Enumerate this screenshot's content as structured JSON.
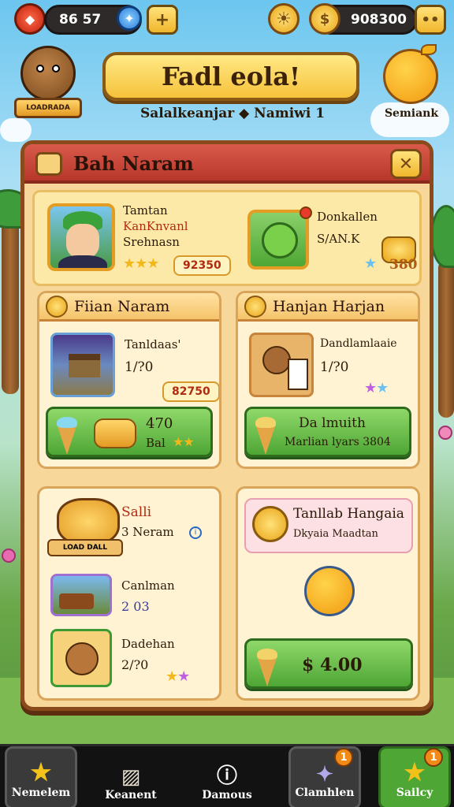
{
  "topbar": {
    "gems_value": "86 57",
    "plus_label": "+",
    "coins_value": "908300"
  },
  "header": {
    "title": "Fadl eola!",
    "subtitle": "Salalkeanjar ◆ Namiwi 1",
    "logo_text": "LOADRADA",
    "bonus_label": "Semiank"
  },
  "panel": {
    "title": "Bah Naram",
    "close_label": "✕"
  },
  "featured": {
    "left": {
      "line1": "Tamtan",
      "line2": "KanKnvanl",
      "line3": "Srehnasn",
      "price": "92350"
    },
    "right": {
      "name": "Donkallen",
      "value": "S/AN.K",
      "coin_value": "380"
    }
  },
  "section_left": {
    "title": "Fiian Naram",
    "item_name": "Tanldaas'",
    "item_count": "1/?0",
    "price": "82750",
    "btn_value": "470",
    "btn_label": "Bal"
  },
  "section_right": {
    "title": "Hanjan Harjan",
    "item_name": "Dandlamlaaie",
    "item_count": "1/?0",
    "btn_title": "Da lmuith",
    "btn_sub": "Marlian lyars 3804"
  },
  "lower_left": {
    "badge_title": "Salli",
    "badge_sub": "3 Neram",
    "item1_name": "Canlman",
    "item1_value": "2 03",
    "item2_name": "Dadehan",
    "item2_value": "2/?0",
    "logo_text": "LOAD DALL"
  },
  "lower_right": {
    "title": "Tanllab Hangaia",
    "subtitle": "Dkyaia Maadtan",
    "buy_label": "$ 4.00"
  },
  "nav": {
    "items": [
      {
        "label": "Nemelem",
        "badge": ""
      },
      {
        "label": "Keanent",
        "badge": ""
      },
      {
        "label": "Damous",
        "badge": ""
      },
      {
        "label": "Clamhlen",
        "badge": "1"
      },
      {
        "label": "Sailcy",
        "badge": "1"
      }
    ]
  },
  "colors": {
    "panel_header": "#c8453a",
    "panel_bg": "#f7d89a",
    "green_button": "#5cb43c",
    "gold": "#f6c23a"
  }
}
